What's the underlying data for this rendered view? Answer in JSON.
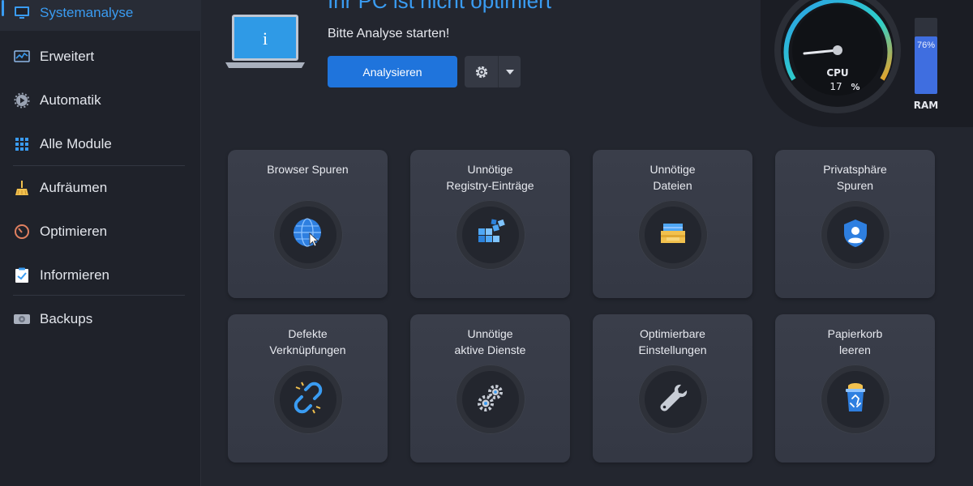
{
  "sidebar": {
    "items": [
      {
        "label": "Systemanalyse",
        "icon": "monitor-icon",
        "active": true
      },
      {
        "label": "Erweitert",
        "icon": "chart-icon"
      },
      {
        "label": "Automatik",
        "icon": "auto-gear-icon"
      },
      {
        "label": "Alle Module",
        "icon": "grid-icon"
      },
      {
        "label": "Aufräumen",
        "icon": "broom-icon"
      },
      {
        "label": "Optimieren",
        "icon": "speedometer-icon"
      },
      {
        "label": "Informieren",
        "icon": "clipboard-icon"
      },
      {
        "label": "Backups",
        "icon": "drive-icon"
      }
    ]
  },
  "header": {
    "headline": "Ihr PC ist nicht optimiert",
    "subline": "Bitte Analyse starten!",
    "analyze_label": "Analysieren"
  },
  "gauge": {
    "cpu_label": "CPU",
    "cpu_value": "17",
    "cpu_unit": "%",
    "ram_value": "76%",
    "ram_label": "RAM",
    "ram_fraction": 0.76
  },
  "cards": [
    {
      "title": "Browser Spuren",
      "icon": "globe-cursor-icon"
    },
    {
      "title": "Unnötige\nRegistry-Einträge",
      "icon": "registry-blocks-icon"
    },
    {
      "title": "Unnötige\nDateien",
      "icon": "file-box-icon"
    },
    {
      "title": "Privatsphäre\nSpuren",
      "icon": "shield-user-icon"
    },
    {
      "title": "Defekte\nVerknüpfungen",
      "icon": "broken-link-icon"
    },
    {
      "title": "Unnötige\naktive Dienste",
      "icon": "gears-icon"
    },
    {
      "title": "Optimierbare\nEinstellungen",
      "icon": "wrench-icon"
    },
    {
      "title": "Papierkorb\nleeren",
      "icon": "recycle-bin-icon"
    }
  ],
  "colors": {
    "accent": "#3a9cf2",
    "primary_button": "#1f74dc",
    "background": "#23262f",
    "card": "#383c48"
  }
}
